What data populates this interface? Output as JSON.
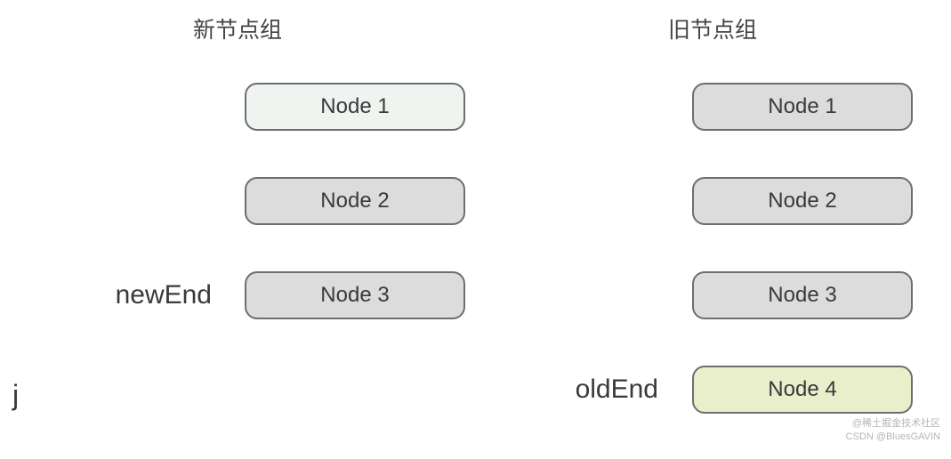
{
  "columns": {
    "left": {
      "title": "新节点组",
      "rows": [
        {
          "label": "",
          "node": "Node 1",
          "fill": "light"
        },
        {
          "label": "",
          "node": "Node 2",
          "fill": "gray"
        },
        {
          "label": "newEnd",
          "node": "Node 3",
          "fill": "gray"
        },
        {
          "label": "j",
          "node": "",
          "fill": ""
        }
      ]
    },
    "right": {
      "title": "旧节点组",
      "rows": [
        {
          "label": "",
          "node": "Node 1",
          "fill": "gray"
        },
        {
          "label": "",
          "node": "Node 2",
          "fill": "gray"
        },
        {
          "label": "",
          "node": "Node 3",
          "fill": "gray"
        },
        {
          "label": "oldEnd",
          "node": "Node 4",
          "fill": "green"
        }
      ]
    }
  },
  "j_label": "j",
  "watermark": {
    "line1": "@稀土掘金技术社区",
    "line2": "CSDN @BluesGAVIN"
  }
}
